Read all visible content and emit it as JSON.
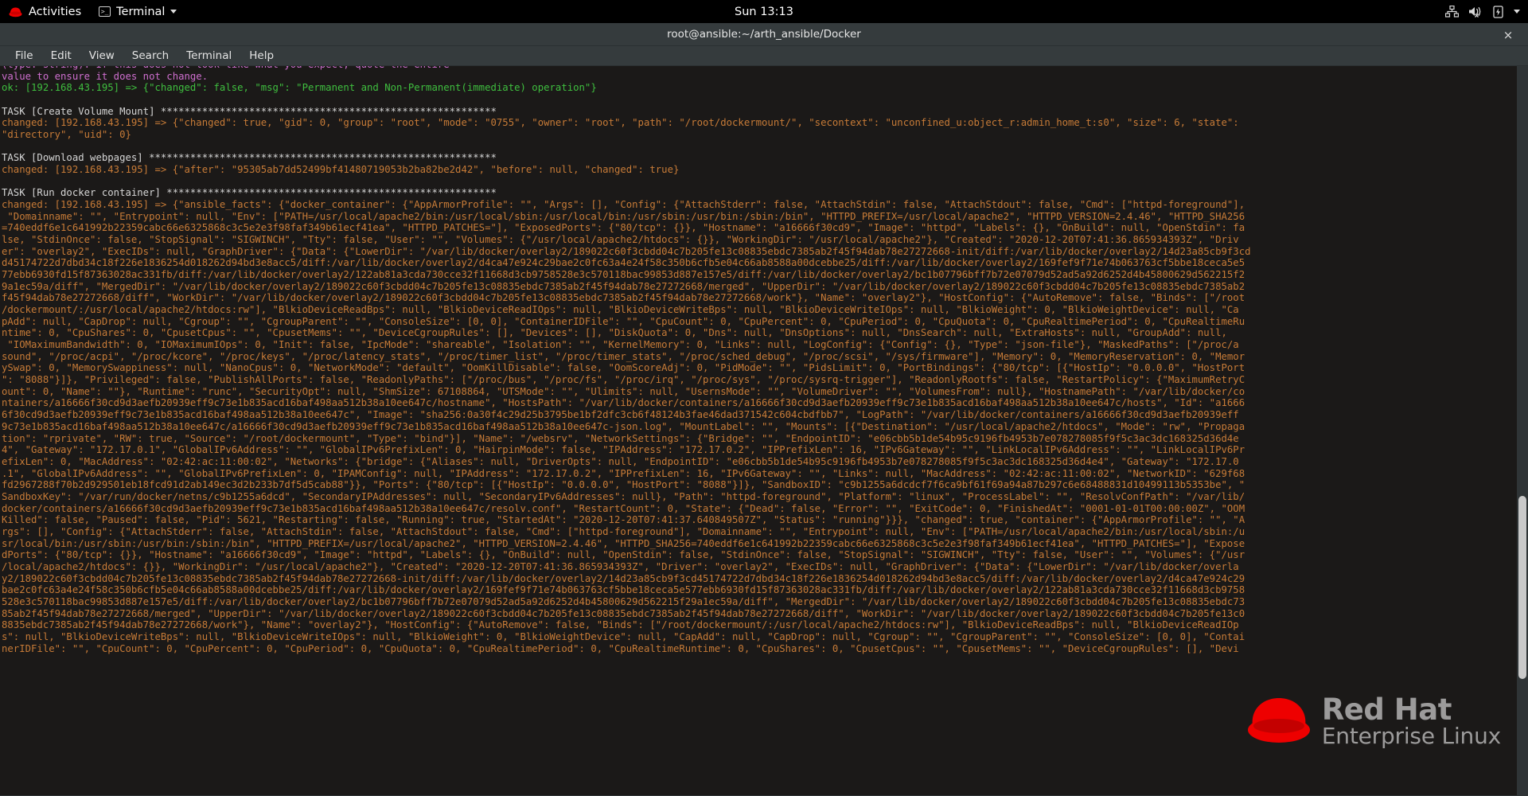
{
  "topbar": {
    "activities": "Activities",
    "app_name": "Terminal",
    "clock": "Sun 13:13",
    "icons": [
      "redhat-logo-icon",
      "terminal-icon",
      "chevron-down-icon",
      "network-icon",
      "volume-muted-icon",
      "battery-icon",
      "system-menu-chevron-icon"
    ]
  },
  "window": {
    "title": "root@ansible:~/arth_ansible/Docker",
    "close_label": "×",
    "menu": [
      "File",
      "Edit",
      "View",
      "Search",
      "Terminal",
      "Help"
    ]
  },
  "watermark": {
    "line1": "Red Hat",
    "line2": "Enterprise Linux"
  },
  "colors": {
    "topbar_bg": "#000000",
    "titlebar_bg": "#353b3d",
    "terminal_bg": "#1b1918",
    "changed_orange": "#c77b37",
    "ok_green": "#3fbf3f",
    "warning_magenta": "#cf6fcf",
    "task_white": "#d6d6d6",
    "redhat_red": "#ee0000"
  },
  "terminal": {
    "lines": [
      {
        "c": "c-mag",
        "t": "(type: string). If this does not look like what you expect, quote the entire"
      },
      {
        "c": "c-mag",
        "t": "value to ensure it does not change."
      },
      {
        "c": "c-grn",
        "t": "ok: [192.168.43.195] => {\"changed\": false, \"msg\": \"Permanent and Non-Permanent(immediate) operation\"}"
      },
      {
        "c": "c-org",
        "t": ""
      },
      {
        "c": "c-wht",
        "t": "TASK [Create Volume Mount] *********************************************************"
      },
      {
        "c": "c-org",
        "t": "changed: [192.168.43.195] => {\"changed\": true, \"gid\": 0, \"group\": \"root\", \"mode\": \"0755\", \"owner\": \"root\", \"path\": \"/root/dockermount/\", \"secontext\": \"unconfined_u:object_r:admin_home_t:s0\", \"size\": 6, \"state\":"
      },
      {
        "c": "c-org",
        "t": "\"directory\", \"uid\": 0}"
      },
      {
        "c": "c-org",
        "t": ""
      },
      {
        "c": "c-wht",
        "t": "TASK [Download webpages] ***********************************************************"
      },
      {
        "c": "c-org",
        "t": "changed: [192.168.43.195] => {\"after\": \"95305ab7dd52499bf41480719053b2ba82be2d42\", \"before\": null, \"changed\": true}"
      },
      {
        "c": "c-org",
        "t": ""
      },
      {
        "c": "c-wht",
        "t": "TASK [Run docker container] ********************************************************"
      },
      {
        "c": "c-org",
        "t": "changed: [192.168.43.195] => {\"ansible_facts\": {\"docker_container\": {\"AppArmorProfile\": \"\", \"Args\": [], \"Config\": {\"AttachStderr\": false, \"AttachStdin\": false, \"AttachStdout\": false, \"Cmd\": [\"httpd-foreground\"],"
      },
      {
        "c": "c-org",
        "t": " \"Domainname\": \"\", \"Entrypoint\": null, \"Env\": [\"PATH=/usr/local/apache2/bin:/usr/local/sbin:/usr/local/bin:/usr/sbin:/usr/bin:/sbin:/bin\", \"HTTPD_PREFIX=/usr/local/apache2\", \"HTTPD_VERSION=2.4.46\", \"HTTPD_SHA256"
      },
      {
        "c": "c-org",
        "t": "=740eddf6e1c641992b22359cabc66e6325868c3c5e2e3f98faf349b61ecf41ea\", \"HTTPD_PATCHES=\"], \"ExposedPorts\": {\"80/tcp\": {}}, \"Hostname\": \"a16666f30cd9\", \"Image\": \"httpd\", \"Labels\": {}, \"OnBuild\": null, \"OpenStdin\": fa"
      },
      {
        "c": "c-org",
        "t": "lse, \"StdinOnce\": false, \"StopSignal\": \"SIGWINCH\", \"Tty\": false, \"User\": \"\", \"Volumes\": {\"/usr/local/apache2/htdocs\": {}}, \"WorkingDir\": \"/usr/local/apache2\"}, \"Created\": \"2020-12-20T07:41:36.865934393Z\", \"Driv"
      },
      {
        "c": "c-org",
        "t": "er\": \"overlay2\", \"ExecIDs\": null, \"GraphDriver\": {\"Data\": {\"LowerDir\": \"/var/lib/docker/overlay2/189022c60f3cbdd04c7b205fe13c08835ebdc7385ab2f45f94dab78e27272668-init/diff:/var/lib/docker/overlay2/14d23a85cb9f3cd"
      },
      {
        "c": "c-org",
        "t": "d45174722d7dbd34c18f226e1836254d018262d94bd3e8acc5/diff:/var/lib/docker/overlay2/d4ca47e924c29bae2c0fc63a4e24f58c350b6cfb5e04c66ab8588a00dcebbe25/diff:/var/lib/docker/overlay2/169fef9f71e74b063763cf5bbe18ceca5e5"
      },
      {
        "c": "c-org",
        "t": "77ebb6930fd15f87363028ac331fb/diff:/var/lib/docker/overlay2/122ab81a3cda730cce32f11668d3cb9758528e3c570118bac99853d887e157e5/diff:/var/lib/docker/overlay2/bc1b07796bff7b72e07079d52ad5a92d6252d4b45800629d562215f2"
      },
      {
        "c": "c-org",
        "t": "9a1ec59a/diff\", \"MergedDir\": \"/var/lib/docker/overlay2/189022c60f3cbdd04c7b205fe13c08835ebdc7385ab2f45f94dab78e27272668/merged\", \"UpperDir\": \"/var/lib/docker/overlay2/189022c60f3cbdd04c7b205fe13c08835ebdc7385ab2"
      },
      {
        "c": "c-org",
        "t": "f45f94dab78e27272668/diff\", \"WorkDir\": \"/var/lib/docker/overlay2/189022c60f3cbdd04c7b205fe13c08835ebdc7385ab2f45f94dab78e27272668/work\"}, \"Name\": \"overlay2\"}, \"HostConfig\": {\"AutoRemove\": false, \"Binds\": [\"/root"
      },
      {
        "c": "c-org",
        "t": "/dockermount/:/usr/local/apache2/htdocs:rw\"], \"BlkioDeviceReadBps\": null, \"BlkioDeviceReadIOps\": null, \"BlkioDeviceWriteBps\": null, \"BlkioDeviceWriteIOps\": null, \"BlkioWeight\": 0, \"BlkioWeightDevice\": null, \"Ca"
      },
      {
        "c": "c-org",
        "t": "pAdd\": null, \"CapDrop\": null, \"Cgroup\": \"\", \"CgroupParent\": \"\", \"ConsoleSize\": [0, 0], \"ContainerIDFile\": \"\", \"CpuCount\": 0, \"CpuPercent\": 0, \"CpuPeriod\": 0, \"CpuQuota\": 0, \"CpuRealtimePeriod\": 0, \"CpuRealtimeRu"
      },
      {
        "c": "c-org",
        "t": "ntime\": 0, \"CpuShares\": 0, \"CpusetCpus\": \"\", \"CpusetMems\": \"\", \"DeviceCgroupRules\": [], \"Devices\": [], \"DiskQuota\": 0, \"Dns\": null, \"DnsOptions\": null, \"DnsSearch\": null, \"ExtraHosts\": null, \"GroupAdd\": null,"
      },
      {
        "c": "c-org",
        "t": " \"IOMaximumBandwidth\": 0, \"IOMaximumIOps\": 0, \"Init\": false, \"IpcMode\": \"shareable\", \"Isolation\": \"\", \"KernelMemory\": 0, \"Links\": null, \"LogConfig\": {\"Config\": {}, \"Type\": \"json-file\"}, \"MaskedPaths\": [\"/proc/a"
      },
      {
        "c": "c-org",
        "t": "sound\", \"/proc/acpi\", \"/proc/kcore\", \"/proc/keys\", \"/proc/latency_stats\", \"/proc/timer_list\", \"/proc/timer_stats\", \"/proc/sched_debug\", \"/proc/scsi\", \"/sys/firmware\"], \"Memory\": 0, \"MemoryReservation\": 0, \"Memor"
      },
      {
        "c": "c-org",
        "t": "ySwap\": 0, \"MemorySwappiness\": null, \"NanoCpus\": 0, \"NetworkMode\": \"default\", \"OomKillDisable\": false, \"OomScoreAdj\": 0, \"PidMode\": \"\", \"PidsLimit\": 0, \"PortBindings\": {\"80/tcp\": [{\"HostIp\": \"0.0.0.0\", \"HostPort"
      },
      {
        "c": "c-org",
        "t": "\": \"8088\"}]}, \"Privileged\": false, \"PublishAllPorts\": false, \"ReadonlyPaths\": [\"/proc/bus\", \"/proc/fs\", \"/proc/irq\", \"/proc/sys\", \"/proc/sysrq-trigger\"], \"ReadonlyRootfs\": false, \"RestartPolicy\": {\"MaximumRetryC"
      },
      {
        "c": "c-org",
        "t": "ount\": 0, \"Name\": \"\"}, \"Runtime\": \"runc\", \"SecurityOpt\": null, \"ShmSize\": 67108864, \"UTSMode\": \"\", \"Ulimits\": null, \"UsernsMode\": \"\", \"VolumeDriver\": \"\", \"VolumesFrom\": null}, \"HostnamePath\": \"/var/lib/docker/co"
      },
      {
        "c": "c-org",
        "t": "ntainers/a16666f30cd9d3aefb20939eff9c73e1b835acd16baf498aa512b38a10ee647c/hostname\", \"HostsPath\": \"/var/lib/docker/containers/a16666f30cd9d3aefb20939eff9c73e1b835acd16baf498aa512b38a10ee647c/hosts\", \"Id\": \"a1666"
      },
      {
        "c": "c-org",
        "t": "6f30cd9d3aefb20939eff9c73e1b835acd16baf498aa512b38a10ee647c\", \"Image\": \"sha256:0a30f4c29d25b3795be1bf2dfc3cb6f48124b3fae46dad371542c604cbdfbb7\", \"LogPath\": \"/var/lib/docker/containers/a16666f30cd9d3aefb20939eff"
      },
      {
        "c": "c-org",
        "t": "9c73e1b835acd16baf498aa512b38a10ee647c/a16666f30cd9d3aefb20939eff9c73e1b835acd16baf498aa512b38a10ee647c-json.log\", \"MountLabel\": \"\", \"Mounts\": [{\"Destination\": \"/usr/local/apache2/htdocs\", \"Mode\": \"rw\", \"Propaga"
      },
      {
        "c": "c-org",
        "t": "tion\": \"rprivate\", \"RW\": true, \"Source\": \"/root/dockermount\", \"Type\": \"bind\"}], \"Name\": \"/websrv\", \"NetworkSettings\": {\"Bridge\": \"\", \"EndpointID\": \"e06cbb5b1de54b95c9196fb4953b7e078278085f9f5c3ac3dc168325d36d4e"
      },
      {
        "c": "c-org",
        "t": "4\", \"Gateway\": \"172.17.0.1\", \"GlobalIPv6Address\": \"\", \"GlobalIPv6PrefixLen\": 0, \"HairpinMode\": false, \"IPAddress\": \"172.17.0.2\", \"IPPrefixLen\": 16, \"IPv6Gateway\": \"\", \"LinkLocalIPv6Address\": \"\", \"LinkLocalIPv6Pr"
      },
      {
        "c": "c-org",
        "t": "efixLen\": 0, \"MacAddress\": \"02:42:ac:11:00:02\", \"Networks\": {\"bridge\": {\"Aliases\": null, \"DriverOpts\": null, \"EndpointID\": \"e06cbb5b1de54b95c9196fb4953b7e078278085f9f5c3ac3dc168325d36d4e4\", \"Gateway\": \"172.17.0"
      },
      {
        "c": "c-org",
        "t": ".1\", \"GlobalIPv6Address\": \"\", \"GlobalIPv6PrefixLen\": 0, \"IPAMConfig\": null, \"IPAddress\": \"172.17.0.2\", \"IPPrefixLen\": 16, \"IPv6Gateway\": \"\", \"Links\": null, \"MacAddress\": \"02:42:ac:11:00:02\", \"NetworkID\": \"629f68"
      },
      {
        "c": "c-org",
        "t": "fd2967288f70b2d929501eb18fcd91d2ab149ec3d2b233b7df5d5cab88\"}}, \"Ports\": {\"80/tcp\": [{\"HostIp\": \"0.0.0.0\", \"HostPort\": \"8088\"}]}, \"SandboxID\": \"c9b1255a6dcdcf7f6ca9bf61f69a94a87b297c6e68488831d10499113b5353be\", \""
      },
      {
        "c": "c-org",
        "t": "SandboxKey\": \"/var/run/docker/netns/c9b1255a6dcd\", \"SecondaryIPAddresses\": null, \"SecondaryIPv6Addresses\": null}, \"Path\": \"httpd-foreground\", \"Platform\": \"linux\", \"ProcessLabel\": \"\", \"ResolvConfPath\": \"/var/lib/"
      },
      {
        "c": "c-org",
        "t": "docker/containers/a16666f30cd9d3aefb20939eff9c73e1b835acd16baf498aa512b38a10ee647c/resolv.conf\", \"RestartCount\": 0, \"State\": {\"Dead\": false, \"Error\": \"\", \"ExitCode\": 0, \"FinishedAt\": \"0001-01-01T00:00:00Z\", \"OOM"
      },
      {
        "c": "c-org",
        "t": "Killed\": false, \"Paused\": false, \"Pid\": 5621, \"Restarting\": false, \"Running\": true, \"StartedAt\": \"2020-12-20T07:41:37.640849507Z\", \"Status\": \"running\"}}}, \"changed\": true, \"container\": {\"AppArmorProfile\": \"\", \"A"
      },
      {
        "c": "c-org",
        "t": "rgs\": [], \"Config\": {\"AttachStderr\": false, \"AttachStdin\": false, \"AttachStdout\": false, \"Cmd\": [\"httpd-foreground\"], \"Domainname\": \"\", \"Entrypoint\": null, \"Env\": [\"PATH=/usr/local/apache2/bin:/usr/local/sbin:/u"
      },
      {
        "c": "c-org",
        "t": "sr/local/bin:/usr/sbin:/usr/bin:/sbin:/bin\", \"HTTPD_PREFIX=/usr/local/apache2\", \"HTTPD_VERSION=2.4.46\", \"HTTPD_SHA256=740eddf6e1c641992b22359cabc66e6325868c3c5e2e3f98faf349b61ecf41ea\", \"HTTPD_PATCHES=\"], \"Expose"
      },
      {
        "c": "c-org",
        "t": "dPorts\": {\"80/tcp\": {}}, \"Hostname\": \"a16666f30cd9\", \"Image\": \"httpd\", \"Labels\": {}, \"OnBuild\": null, \"OpenStdin\": false, \"StdinOnce\": false, \"StopSignal\": \"SIGWINCH\", \"Tty\": false, \"User\": \"\", \"Volumes\": {\"/usr"
      },
      {
        "c": "c-org",
        "t": "/local/apache2/htdocs\": {}}, \"WorkingDir\": \"/usr/local/apache2\"}, \"Created\": \"2020-12-20T07:41:36.865934393Z\", \"Driver\": \"overlay2\", \"ExecIDs\": null, \"GraphDriver\": {\"Data\": {\"LowerDir\": \"/var/lib/docker/overla"
      },
      {
        "c": "c-org",
        "t": "y2/189022c60f3cbdd04c7b205fe13c08835ebdc7385ab2f45f94dab78e27272668-init/diff:/var/lib/docker/overlay2/14d23a85cb9f3cd45174722d7dbd34c18f226e1836254d018262d94bd3e8acc5/diff:/var/lib/docker/overlay2/d4ca47e924c29"
      },
      {
        "c": "c-org",
        "t": "bae2c0fc63a4e24f58c350b6cfb5e04c66ab8588a00dcebbe25/diff:/var/lib/docker/overlay2/169fef9f71e74b063763cf5bbe18ceca5e577ebb6930fd15f87363028ac331fb/diff:/var/lib/docker/overlay2/122ab81a3cda730cce32f11668d3cb9758"
      },
      {
        "c": "c-org",
        "t": "528e3c570118bac99853d887e157e5/diff:/var/lib/docker/overlay2/bc1b07796bff7b72e07079d52ad5a92d6252d4b45800629d562215f29a1ec59a/diff\", \"MergedDir\": \"/var/lib/docker/overlay2/189022c60f3cbdd04c7b205fe13c08835ebdc73"
      },
      {
        "c": "c-org",
        "t": "85ab2f45f94dab78e27272668/merged\", \"UpperDir\": \"/var/lib/docker/overlay2/189022c60f3cbdd04c7b205fe13c08835ebdc7385ab2f45f94dab78e27272668/diff\", \"WorkDir\": \"/var/lib/docker/overlay2/189022c60f3cbdd04c7b205fe13c0"
      },
      {
        "c": "c-org",
        "t": "8835ebdc7385ab2f45f94dab78e27272668/work\"}, \"Name\": \"overlay2\"}, \"HostConfig\": {\"AutoRemove\": false, \"Binds\": [\"/root/dockermount/:/usr/local/apache2/htdocs:rw\"], \"BlkioDeviceReadBps\": null, \"BlkioDeviceReadIOp"
      },
      {
        "c": "c-org",
        "t": "s\": null, \"BlkioDeviceWriteBps\": null, \"BlkioDeviceWriteIOps\": null, \"BlkioWeight\": 0, \"BlkioWeightDevice\": null, \"CapAdd\": null, \"CapDrop\": null, \"Cgroup\": \"\", \"CgroupParent\": \"\", \"ConsoleSize\": [0, 0], \"Contai"
      },
      {
        "c": "c-org",
        "t": "nerIDFile\": \"\", \"CpuCount\": 0, \"CpuPercent\": 0, \"CpuPeriod\": 0, \"CpuQuota\": 0, \"CpuRealtimePeriod\": 0, \"CpuRealtimeRuntime\": 0, \"CpuShares\": 0, \"CpusetCpus\": \"\", \"CpusetMems\": \"\", \"DeviceCgroupRules\": [], \"Devi"
      }
    ]
  }
}
